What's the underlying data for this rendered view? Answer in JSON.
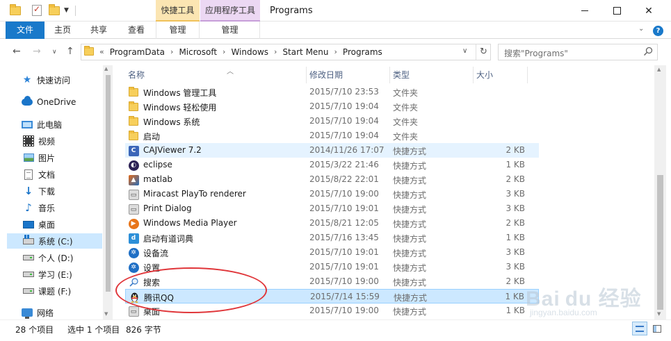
{
  "titlebar": {
    "title": "Programs",
    "context_tabs": [
      {
        "header": "快捷工具",
        "tab": "管理",
        "color": "#fbe5b2"
      },
      {
        "header": "应用程序工具",
        "tab": "管理",
        "color": "#ecd8f3"
      }
    ]
  },
  "ribbon": {
    "tabs": [
      "文件",
      "主页",
      "共享",
      "查看"
    ],
    "accent": "#1979ca",
    "help": "?"
  },
  "address": {
    "prefix": "«",
    "crumbs": [
      "ProgramData",
      "Microsoft",
      "Windows",
      "Start Menu",
      "Programs"
    ],
    "separator": "›"
  },
  "search": {
    "placeholder": "搜索\"Programs\""
  },
  "sidebar": {
    "items": [
      {
        "label": "快速访问",
        "icon": "star-icon"
      },
      {
        "label": "OneDrive",
        "icon": "cloud-icon"
      },
      {
        "label": "此电脑",
        "icon": "computer-icon"
      },
      {
        "label": "视频",
        "icon": "video-icon"
      },
      {
        "label": "图片",
        "icon": "picture-icon"
      },
      {
        "label": "文档",
        "icon": "document-icon"
      },
      {
        "label": "下载",
        "icon": "download-icon"
      },
      {
        "label": "音乐",
        "icon": "music-icon"
      },
      {
        "label": "桌面",
        "icon": "desktop-icon"
      },
      {
        "label": "系统 (C:)",
        "icon": "windows-drive-icon"
      },
      {
        "label": "个人 (D:)",
        "icon": "drive-icon"
      },
      {
        "label": "学习 (E:)",
        "icon": "drive-icon"
      },
      {
        "label": "课题 (F:)",
        "icon": "drive-icon"
      },
      {
        "label": "网络",
        "icon": "network-icon"
      }
    ]
  },
  "columns": {
    "name": "名称",
    "date": "修改日期",
    "type": "类型",
    "size": "大小"
  },
  "files": [
    {
      "name": "Windows 管理工具",
      "date": "2015/7/10 23:53",
      "type": "文件夹",
      "size": "",
      "icon": "folder-icon"
    },
    {
      "name": "Windows 轻松使用",
      "date": "2015/7/10 19:04",
      "type": "文件夹",
      "size": "",
      "icon": "folder-icon"
    },
    {
      "name": "Windows 系统",
      "date": "2015/7/10 19:04",
      "type": "文件夹",
      "size": "",
      "icon": "folder-icon"
    },
    {
      "name": "启动",
      "date": "2015/7/10 19:04",
      "type": "文件夹",
      "size": "",
      "icon": "folder-icon"
    },
    {
      "name": "CAJViewer 7.2",
      "date": "2014/11/26 17:07",
      "type": "快捷方式",
      "size": "2 KB",
      "icon": "cajviewer-icon"
    },
    {
      "name": "eclipse",
      "date": "2015/3/22 21:46",
      "type": "快捷方式",
      "size": "1 KB",
      "icon": "eclipse-icon"
    },
    {
      "name": "matlab",
      "date": "2015/8/22 22:01",
      "type": "快捷方式",
      "size": "2 KB",
      "icon": "matlab-icon"
    },
    {
      "name": "Miracast PlayTo renderer",
      "date": "2015/7/10 19:00",
      "type": "快捷方式",
      "size": "3 KB",
      "icon": "miracast-icon"
    },
    {
      "name": "Print Dialog",
      "date": "2015/7/10 19:01",
      "type": "快捷方式",
      "size": "3 KB",
      "icon": "print-icon"
    },
    {
      "name": "Windows Media Player",
      "date": "2015/8/21 12:05",
      "type": "快捷方式",
      "size": "2 KB",
      "icon": "media-player-icon"
    },
    {
      "name": "启动有道词典",
      "date": "2015/7/16 13:45",
      "type": "快捷方式",
      "size": "1 KB",
      "icon": "youdao-icon"
    },
    {
      "name": "设备流",
      "date": "2015/7/10 19:01",
      "type": "快捷方式",
      "size": "3 KB",
      "icon": "gear-icon"
    },
    {
      "name": "设置",
      "date": "2015/7/10 19:01",
      "type": "快捷方式",
      "size": "3 KB",
      "icon": "gear-icon"
    },
    {
      "name": "搜索",
      "date": "2015/7/10 19:00",
      "type": "快捷方式",
      "size": "2 KB",
      "icon": "search-icon"
    },
    {
      "name": "腾讯QQ",
      "date": "2015/7/14 15:59",
      "type": "快捷方式",
      "size": "1 KB",
      "icon": "qq-penguin-icon"
    },
    {
      "name": "桌面",
      "date": "2015/7/10 19:00",
      "type": "快捷方式",
      "size": "1 KB",
      "icon": "desktop-icon"
    }
  ],
  "status": {
    "count": "28 个项目",
    "selected": "选中 1 个项目",
    "size": "826 字节"
  },
  "annotation_color": "#e0363a",
  "watermark": {
    "main": "Bai du 经验",
    "sub": "jingyan.baidu.com"
  }
}
